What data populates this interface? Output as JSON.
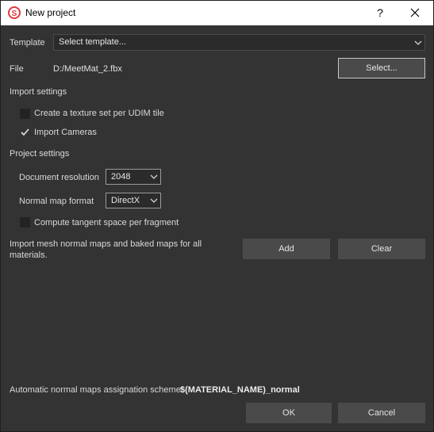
{
  "window": {
    "title": "New project",
    "help_label": "?",
    "icons": {
      "app": "substance-painter-logo-icon",
      "close": "close-icon"
    }
  },
  "template": {
    "label": "Template",
    "selected": "Select template..."
  },
  "file": {
    "label": "File",
    "value": "D:/MeetMat_2.fbx",
    "select_button": "Select..."
  },
  "import_settings": {
    "heading": "Import settings",
    "udim_checkbox": {
      "label": "Create a texture set per UDIM tile",
      "checked": false
    },
    "cameras_checkbox": {
      "label": "Import Cameras",
      "checked": true
    }
  },
  "project_settings": {
    "heading": "Project settings",
    "document_resolution": {
      "label": "Document resolution",
      "value": "2048"
    },
    "normal_map_format": {
      "label": "Normal map format",
      "value": "DirectX"
    },
    "tangent_checkbox": {
      "label": "Compute tangent space per fragment",
      "checked": false
    }
  },
  "mesh_maps": {
    "description_line1": "Import mesh normal maps and baked maps for all",
    "description_line2": "materials.",
    "add_button": "Add",
    "clear_button": "Clear"
  },
  "footer": {
    "scheme_label": "Automatic normal maps assignation scheme:",
    "scheme_value": "$(MATERIAL_NAME)_normal",
    "ok_button": "OK",
    "cancel_button": "Cancel"
  },
  "colors": {
    "background": "#333333",
    "field": "#2b2b2b",
    "button": "#4a4a4a",
    "logo_red": "#e0383e"
  }
}
